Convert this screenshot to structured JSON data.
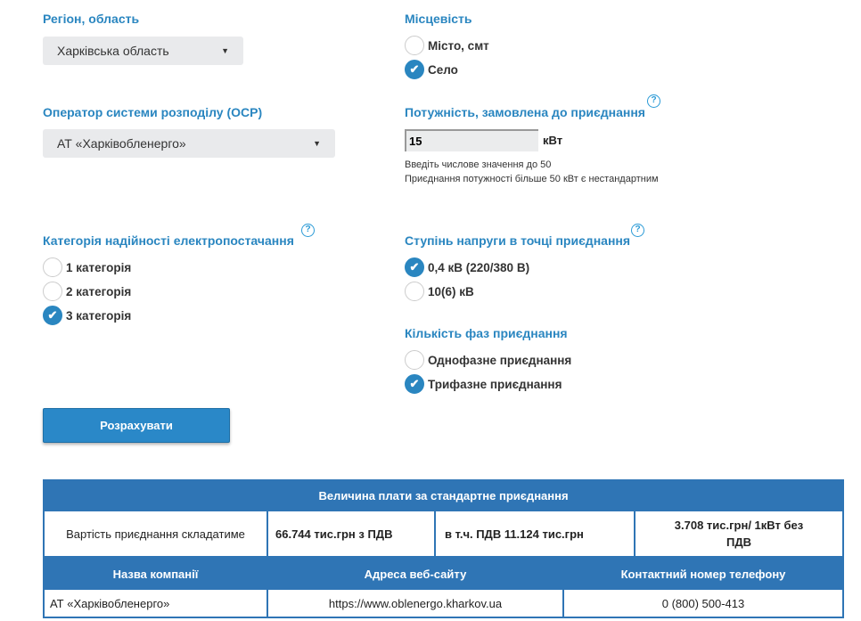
{
  "region": {
    "label": "Регіон, область",
    "value": "Харківська область"
  },
  "osr": {
    "label": "Оператор системи розподілу (ОСР)",
    "value": "АТ «Харківобленерго»"
  },
  "locality": {
    "label": "Місцевість",
    "options": [
      {
        "label": "Місто, смт",
        "checked": false
      },
      {
        "label": "Село",
        "checked": true
      }
    ]
  },
  "power": {
    "label": "Потужність, замовлена до приєднання",
    "value": "15",
    "unit": "кВт",
    "hint1": "Введіть числове значення до 50",
    "hint2": "Приєднання потужності більше 50 кВт є нестандартним",
    "help": "?"
  },
  "reliability": {
    "label": "Категорія надійності електропостачання",
    "help": "?",
    "options": [
      {
        "label": "1 категорія",
        "checked": false
      },
      {
        "label": "2 категорія",
        "checked": false
      },
      {
        "label": "3 категорія",
        "checked": true
      }
    ]
  },
  "voltage": {
    "label": "Ступінь напруги в точці приєднання",
    "help": "?",
    "options": [
      {
        "label": "0,4 кВ (220/380 В)",
        "checked": true
      },
      {
        "label": "10(6) кВ",
        "checked": false
      }
    ]
  },
  "phases": {
    "label": "Кількість фаз приєднання",
    "options": [
      {
        "label": "Однофазне приєднання",
        "checked": false
      },
      {
        "label": "Трифазне приєднання",
        "checked": true
      }
    ]
  },
  "calculate_label": "Розрахувати",
  "result": {
    "title": "Величина плати за стандартне приєднання",
    "row_label": "Вартість приєднання складатиме",
    "total": "66.744 тис.грн з ПДВ",
    "vat": "в т.ч. ПДВ 11.124 тис.грн",
    "per_kw": "3.708 тис.грн/ 1кВт без ПДВ",
    "headers": [
      "Назва компанії",
      "Адреса веб-сайту",
      "Контактний номер телефону"
    ],
    "company": "АТ «Харківобленерго»",
    "website": "https://www.oblenergo.kharkov.ua",
    "phone": "0 (800) 500-413"
  }
}
